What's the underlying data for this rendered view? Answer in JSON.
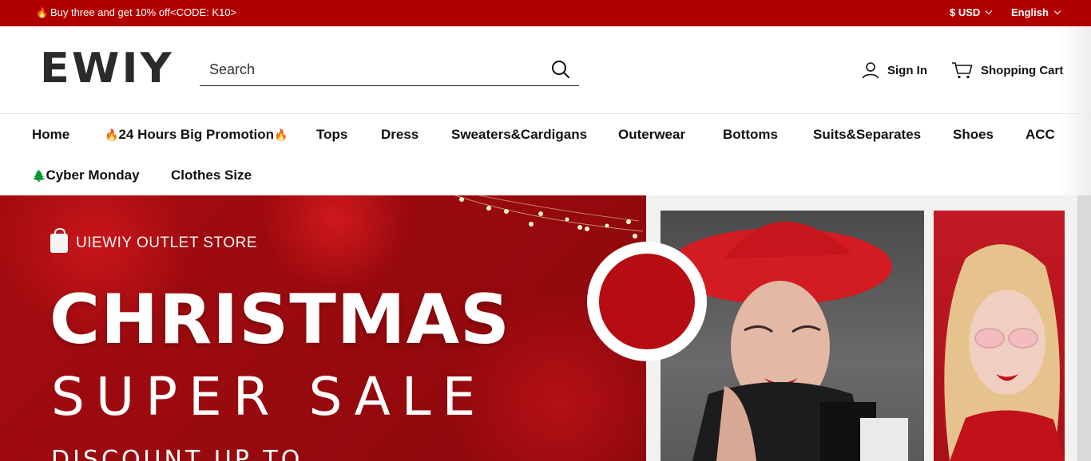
{
  "topbar": {
    "promo_text": "Buy three and get 10% off<CODE: K10>",
    "promo_icon": "flame-icon",
    "currency": "$ USD",
    "language": "English",
    "bg_color": "#b10000"
  },
  "header": {
    "logo_text": "EWIY",
    "search": {
      "placeholder": "Search"
    },
    "sign_in": "Sign In",
    "cart": "Shopping Cart"
  },
  "nav": {
    "items": [
      {
        "label": "Home"
      },
      {
        "label": "24 Hours Big Promotion",
        "icon": "flame-icon"
      },
      {
        "label": "Tops"
      },
      {
        "label": "Dress"
      },
      {
        "label": "Sweaters&Cardigans"
      },
      {
        "label": "Outerwear"
      },
      {
        "label": "Bottoms"
      },
      {
        "label": "Suits&Separates"
      },
      {
        "label": "Shoes"
      },
      {
        "label": "ACC"
      },
      {
        "label": "Cyber Monday",
        "icon": "christmas-tree-icon"
      },
      {
        "label": "Clothes Size"
      }
    ]
  },
  "hero": {
    "store_name": "UIEWIY OUTLET STORE",
    "title": "CHRISTMAS",
    "subtitle": "SUPER SALE",
    "discount_partial": "DISCOUNT UP TO",
    "bg_color": "#a50c10"
  }
}
